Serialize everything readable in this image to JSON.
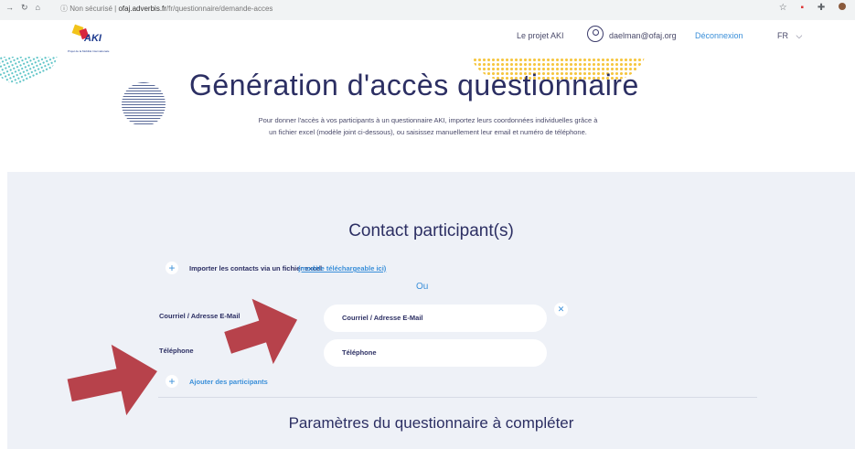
{
  "browser": {
    "url_prefix": "Non sécurisé | ",
    "url_host": "ofaj.adverbis.fr",
    "url_path": "/fr/questionnaire/demande-acces"
  },
  "header": {
    "logo_text": "AKI",
    "logo_subtitle": "Projet de la Mobilité Internationale",
    "nav_project": "Le projet AKI",
    "user_email": "daelman@ofaj.org",
    "logout": "Déconnexion",
    "language": "FR"
  },
  "hero": {
    "title": "Génération d'accès questionnaire",
    "intro": "Pour donner l'accès à vos participants à un questionnaire AKI, importez leurs coordonnées individuelles grâce à un fichier excel (modèle joint ci-dessous), ou saisissez manuellement leur email et numéro de téléphone."
  },
  "form": {
    "section_title": "Contact participant(s)",
    "import_label": "Importer les contacts via un fichier excel",
    "import_link": "(modèle téléchargeable ici)",
    "or_label": "Ou",
    "email_label": "Courriel / Adresse E-Mail",
    "email_placeholder": "Courriel / Adresse E-Mail",
    "phone_label": "Téléphone",
    "phone_placeholder": "Téléphone",
    "add_participants": "Ajouter des participants",
    "params_title": "Paramètres du questionnaire à compléter"
  },
  "colors": {
    "primary": "#2c2f63",
    "accent": "#3a8fd9",
    "section_bg": "#eef1f7",
    "arrow": "#b7424b"
  }
}
